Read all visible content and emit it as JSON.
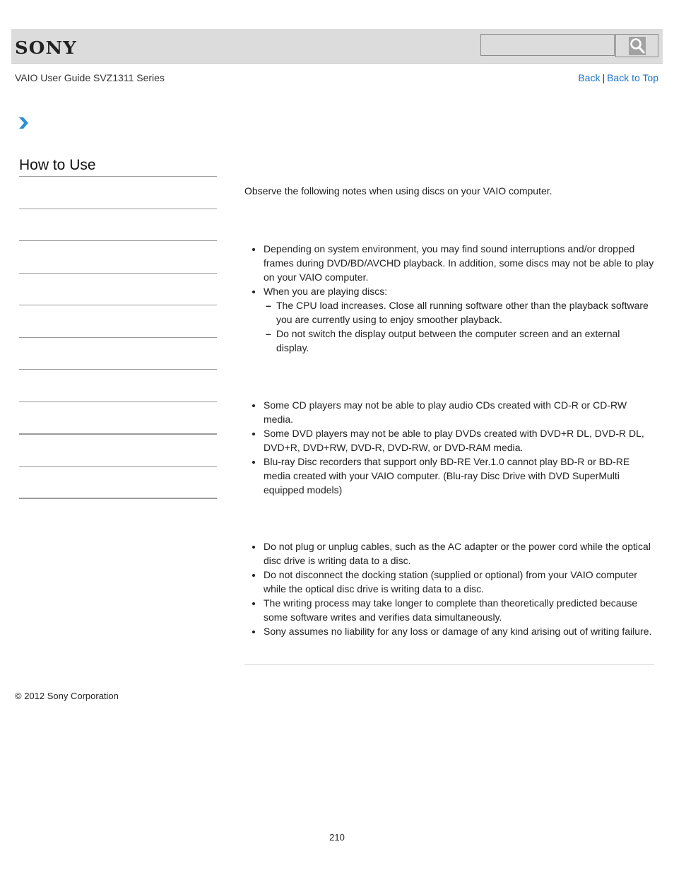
{
  "header": {
    "logo": "SONY",
    "search_placeholder": "",
    "search_icon": "magnifier-icon"
  },
  "subheader": {
    "guide_title": "VAIO User Guide SVZ1311 Series",
    "back_label": "Back",
    "separator": "|",
    "back_to_top_label": "Back to Top"
  },
  "breadcrumb": {
    "icon": "chevron-right-icon"
  },
  "sidebar": {
    "heading": "How to Use",
    "items": [
      "",
      "",
      "",
      "",
      "",
      "",
      "",
      "",
      "",
      ""
    ]
  },
  "main": {
    "intro": "Observe the following notes when using discs on your VAIO computer.",
    "section1": {
      "items": [
        "Depending on system environment, you may find sound interruptions and/or dropped frames during DVD/BD/AVCHD playback. In addition, some discs may not be able to play on your VAIO computer.",
        "When you are playing discs:"
      ],
      "subitems": [
        "The CPU load increases. Close all running software other than the playback software you are currently using to enjoy smoother playback.",
        "Do not switch the display output between the computer screen and an external display."
      ]
    },
    "section2": {
      "items": [
        "Some CD players may not be able to play audio CDs created with CD-R or CD-RW media.",
        "Some DVD players may not be able to play DVDs created with DVD+R DL, DVD-R DL, DVD+R, DVD+RW, DVD-R, DVD-RW, or DVD-RAM media.",
        "Blu-ray Disc recorders that support only BD-RE Ver.1.0 cannot play BD-R or BD-RE media created with your VAIO computer. (Blu-ray Disc Drive with DVD SuperMulti equipped models)"
      ]
    },
    "section3": {
      "items": [
        "Do not plug or unplug cables, such as the AC adapter or the power cord while the optical disc drive is writing data to a disc.",
        "Do not disconnect the docking station (supplied or optional) from your VAIO computer while the optical disc drive is writing data to a disc.",
        "The writing process may take longer to complete than theoretically predicted because some software writes and verifies data simultaneously.",
        "Sony assumes no liability for any loss or damage of any kind arising out of writing failure."
      ]
    }
  },
  "footer": {
    "copyright": "© 2012 Sony Corporation",
    "page_number": "210"
  },
  "colors": {
    "link": "#1a73c8",
    "header_bg": "#dcdcdc",
    "chevron": "#2e8fd6"
  }
}
